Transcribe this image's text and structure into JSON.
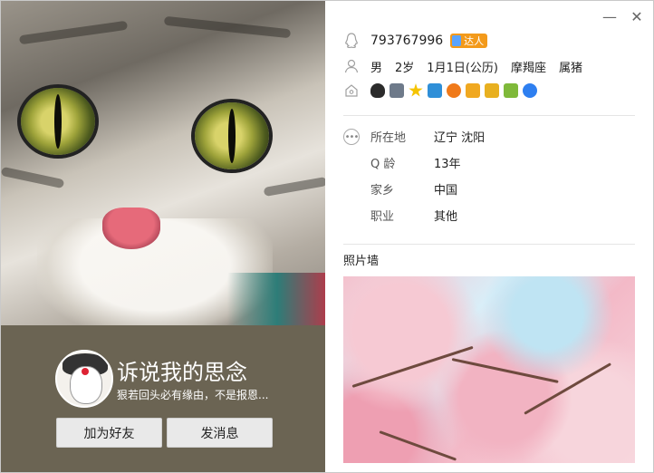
{
  "profile": {
    "nickname": "诉说我的思念",
    "signature": "狠若回头必有缘由，不是报恩..."
  },
  "buttons": {
    "add_friend": "加为好友",
    "send_message": "发消息"
  },
  "window": {
    "minimize": "—",
    "close": "✕"
  },
  "account": {
    "qq_number": "793767996",
    "badge_label": "达人"
  },
  "basic": {
    "gender": "男",
    "age": "2岁",
    "birthday": "1月1日(公历)",
    "zodiac": "摩羯座",
    "chinese_zodiac": "属猪"
  },
  "badges": [
    {
      "name": "qq-penguin-badge-icon",
      "color": "#2b2b2b"
    },
    {
      "name": "diamond-badge-icon",
      "color": "#6e7a8a"
    },
    {
      "name": "star-badge-icon",
      "color": "#f5c400"
    },
    {
      "name": "camera-badge-icon",
      "color": "#2f8fd8"
    },
    {
      "name": "music-badge-icon",
      "color": "#f07a1a"
    },
    {
      "name": "coin-badge-icon",
      "color": "#f0a820"
    },
    {
      "name": "game-badge-icon",
      "color": "#e8b020"
    },
    {
      "name": "wallet-badge-icon",
      "color": "#7fb93a"
    },
    {
      "name": "browser-badge-icon",
      "color": "#2e7ff0"
    }
  ],
  "details": [
    {
      "key": "所在地",
      "value": "辽宁 沈阳"
    },
    {
      "key": "Q 龄",
      "value": "13年"
    },
    {
      "key": "家乡",
      "value": "中国"
    },
    {
      "key": "职业",
      "value": "其他"
    }
  ],
  "photo_wall": {
    "title": "照片墙"
  }
}
